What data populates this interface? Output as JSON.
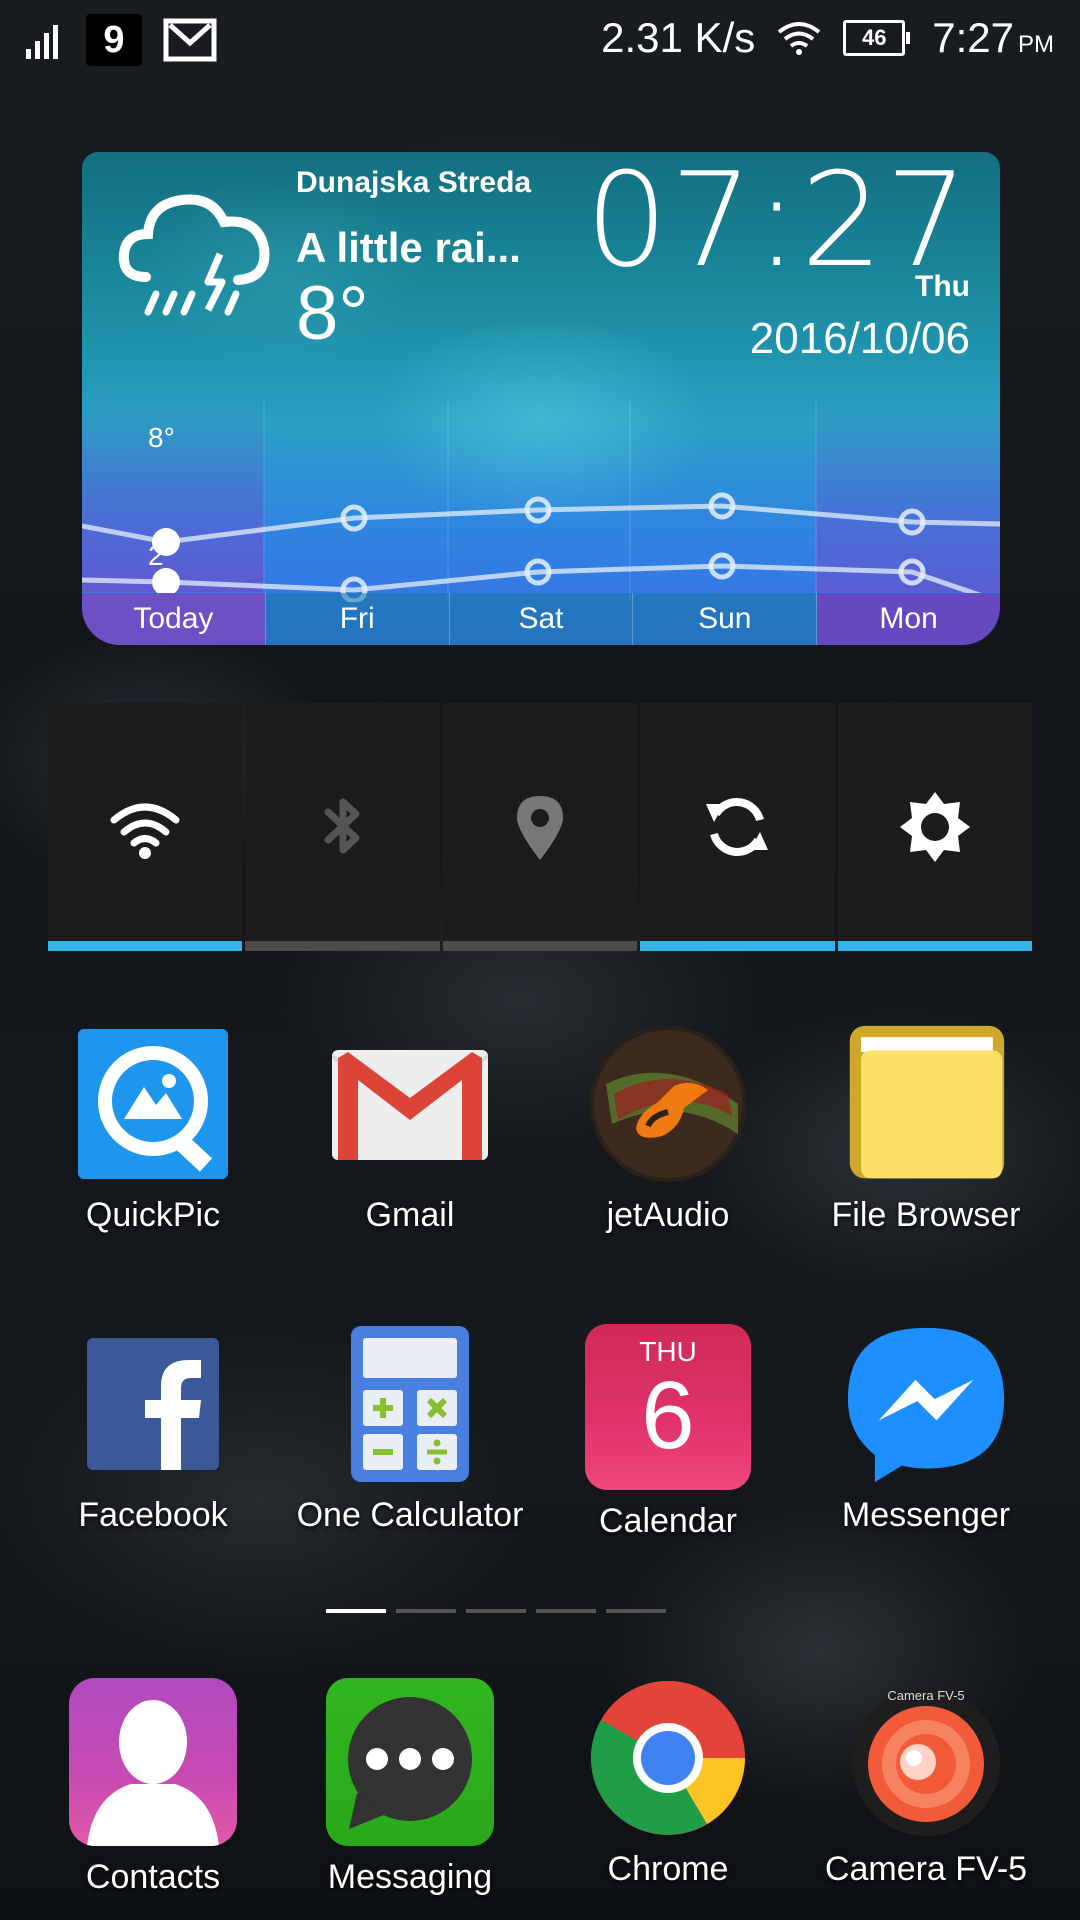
{
  "status_bar": {
    "net_speed": "2.31 K/s",
    "battery": "46",
    "time": "7:27",
    "ampm": "PM"
  },
  "weather": {
    "city": "Dunajska Streda",
    "condition": "A little rai...",
    "temp": "8°",
    "clock": "07:27",
    "day": "Thu",
    "date": "2016/10/06",
    "high_label": "8°",
    "low_label": "2°",
    "days": [
      "Today",
      "Fri",
      "Sat",
      "Sun",
      "Mon"
    ]
  },
  "toggles": [
    {
      "icon": "wifi-icon",
      "on": true
    },
    {
      "icon": "bluetooth-icon",
      "on": false
    },
    {
      "icon": "location-icon",
      "on": false
    },
    {
      "icon": "sync-icon",
      "on": true
    },
    {
      "icon": "brightness-icon",
      "on": true
    }
  ],
  "apps": {
    "row1": [
      "QuickPic",
      "Gmail",
      "jetAudio",
      "File Browser"
    ],
    "row2": [
      "Facebook",
      "One Calculator",
      "Calendar",
      "Messenger"
    ],
    "dock": [
      "Contacts",
      "Messaging",
      "Chrome",
      "Camera FV-5"
    ]
  },
  "calendar_icon": {
    "weekday": "THU",
    "day": "6"
  },
  "camera_icon_text": "Camera FV-5",
  "colors": {
    "toggle_on": "#36b4e8",
    "toggle_off": "#4c4c4c"
  }
}
